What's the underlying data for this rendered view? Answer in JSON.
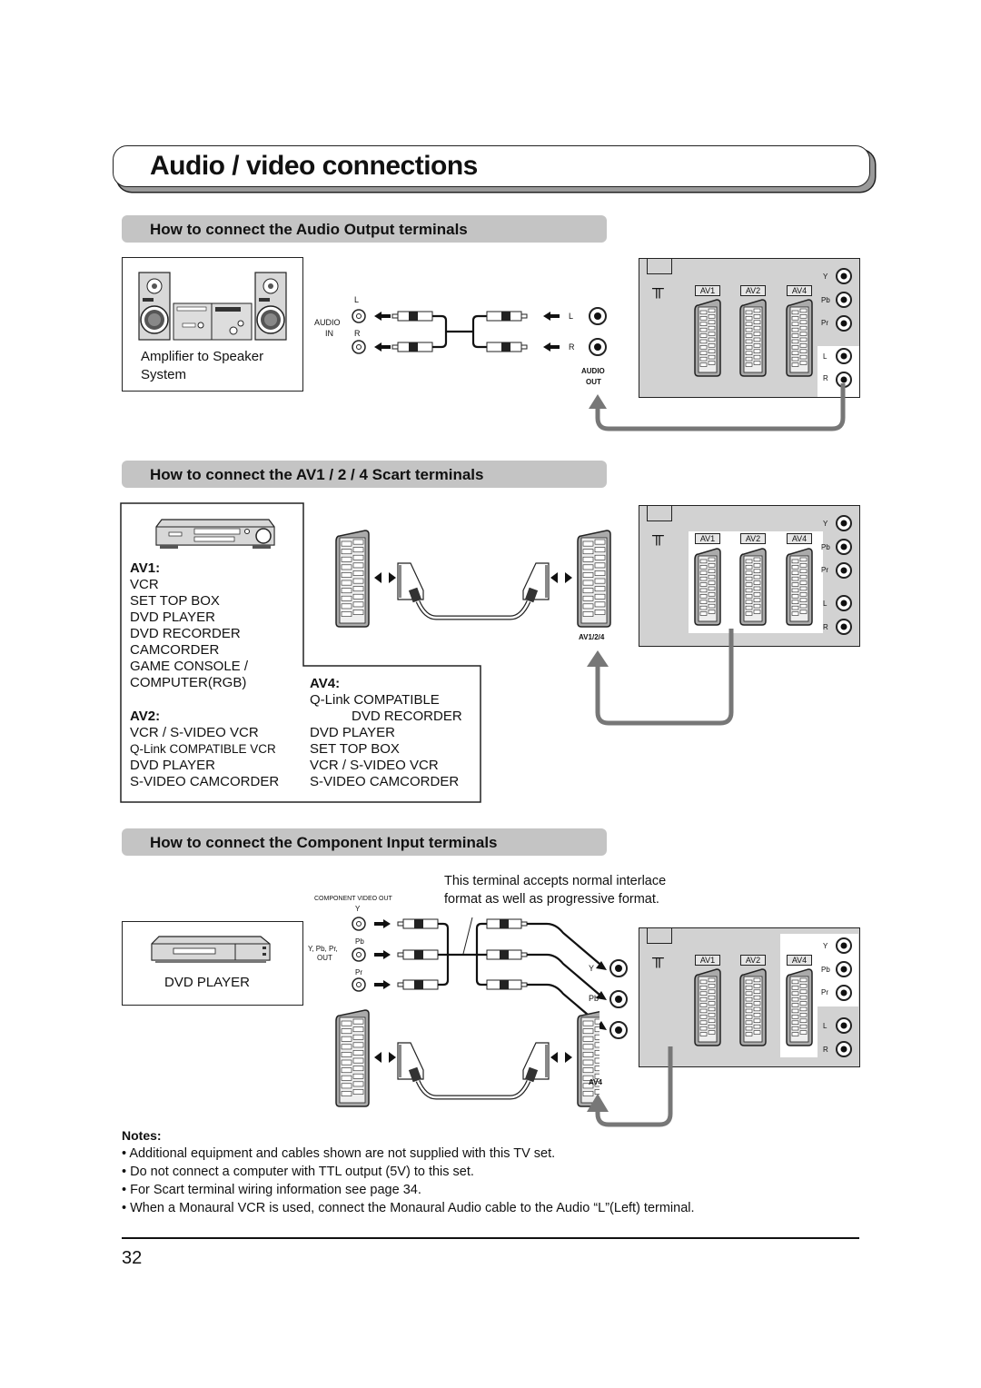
{
  "page": {
    "title": "Audio / video connections",
    "page_number": "32"
  },
  "audio_section": {
    "heading": "How to connect the Audio Output terminals",
    "device_label_line1": "Amplifier to Speaker",
    "device_label_line2": "System",
    "audio_in_line1": "AUDIO",
    "audio_in_line2": "IN",
    "jack_l": "L",
    "jack_r": "R",
    "audio_out_line1": "AUDIO",
    "audio_out_line2": "OUT"
  },
  "tv_panel": {
    "av_labels": [
      "AV1",
      "AV2",
      "AV4"
    ],
    "jack_labels": [
      "Y",
      "Pb",
      "Pr",
      "L",
      "R"
    ]
  },
  "scart_section": {
    "heading": "How to connect the AV1 / 2 / 4 Scart terminals",
    "connector_label": "AV1/2/4",
    "av1": {
      "title": "AV1:",
      "items": [
        "VCR",
        "SET TOP BOX",
        "DVD PLAYER",
        "DVD RECORDER",
        "CAMCORDER",
        "GAME CONSOLE /",
        "COMPUTER(RGB)"
      ]
    },
    "av2": {
      "title": "AV2:",
      "items": [
        "VCR / S-VIDEO VCR",
        "Q-Link COMPATIBLE VCR",
        "DVD PLAYER",
        "S-VIDEO CAMCORDER"
      ]
    },
    "av4": {
      "title": "AV4:",
      "items": [
        "Q-Link COMPATIBLE",
        "DVD RECORDER",
        "DVD PLAYER",
        "SET TOP BOX",
        "VCR / S-VIDEO VCR",
        "S-VIDEO CAMCORDER"
      ]
    }
  },
  "component_section": {
    "heading": "How to connect the Component Input terminals",
    "callout_line1": "This terminal accepts normal interlace",
    "callout_line2": "format as well as progressive format.",
    "device_label": "DVD PLAYER",
    "component_out_label": "COMPONENT VIDEO OUT",
    "out_y": "Y",
    "out_pb": "Pb",
    "out_pr": "Pr",
    "out_group_line1": "Y, Pb, Pr,",
    "out_group_line2": "OUT",
    "in_y": "Y",
    "in_pb": "Pb",
    "in_pr": "Pr",
    "scart_label": "AV4"
  },
  "notes": {
    "title": "Notes:",
    "items": [
      "Additional equipment and cables shown are not supplied with this TV set.",
      "Do not connect a computer with TTL output (5V) to this set.",
      "For Scart terminal wiring information see page 34.",
      "When a Monaural VCR is used, connect the Monaural Audio cable to the Audio “L”(Left) terminal."
    ]
  }
}
